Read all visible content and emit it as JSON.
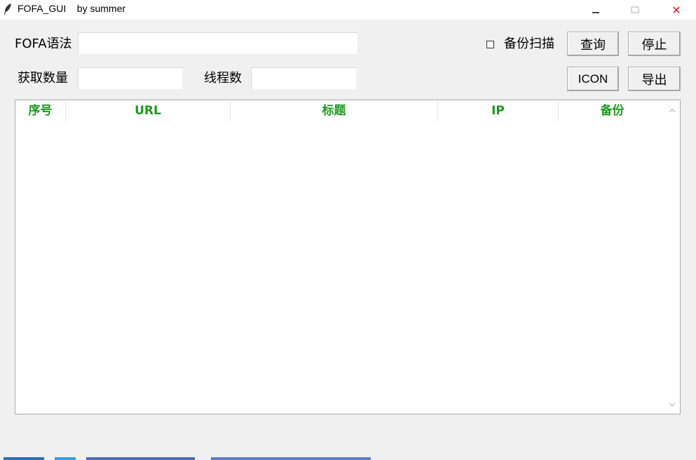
{
  "window": {
    "title": "FOFA_GUI    by summer"
  },
  "form": {
    "fofa_label": "FOFA语法",
    "fofa_value": "",
    "count_label": "获取数量",
    "count_value": "",
    "threads_label": "线程数",
    "threads_value": "",
    "backup_scan_label": "备份扫描",
    "backup_scan_checked": false
  },
  "buttons": {
    "query": "查询",
    "stop": "停止",
    "icon": "ICON",
    "export": "导出"
  },
  "table": {
    "columns": [
      "序号",
      "URL",
      "标题",
      "IP",
      "备份"
    ],
    "rows": []
  },
  "colors": {
    "header_text": "#1e9a1e",
    "close_icon": "#e81123"
  },
  "icons": {
    "app": "feather-icon",
    "minimize": "minimize-icon",
    "maximize": "maximize-icon",
    "close": "close-icon",
    "scroll_up": "chevron-up-icon",
    "scroll_down": "chevron-down-icon"
  }
}
